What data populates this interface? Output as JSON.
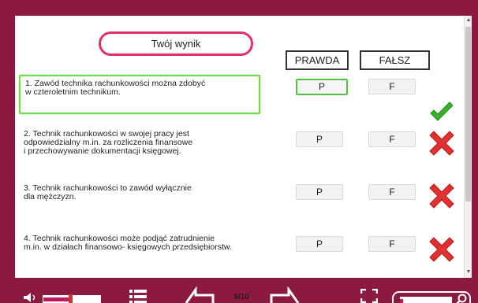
{
  "result_title": "Twój wynik",
  "headers": {
    "true_label": "PRAWDA",
    "false_label": "FAŁSZ"
  },
  "questions": [
    {
      "text": "1. Zawód technika rachunkowości można zdobyć\nw czteroletnim technikum.",
      "true_button": "P",
      "false_button": "F",
      "selected_answer": "P",
      "result": "correct",
      "result_icon": "check-icon"
    },
    {
      "text": "2. Technik rachunkowości w swojej pracy jest\nodpowiedzialny m.in. za rozliczenia finansowe\ni przechowywanie  dokumentacji księgowej.",
      "true_button": "P",
      "false_button": "F",
      "selected_answer": "",
      "result": "incorrect",
      "result_icon": "cross-icon"
    },
    {
      "text": "3. Technik rachunkowości to zawód wyłącznie\ndla mężczyzn.",
      "true_button": "P",
      "false_button": "F",
      "selected_answer": "",
      "result": "incorrect",
      "result_icon": "cross-icon"
    },
    {
      "text": "4. Technik rachunkowości może podjąć zatrudnienie\nm.in. w działach finansowo- księgowych przedsiębiorstw.",
      "true_button": "P",
      "false_button": "F",
      "selected_answer": "",
      "result": "incorrect",
      "result_icon": "cross-icon"
    }
  ],
  "footer": {
    "page_counter": "9/10",
    "volume_level": 0.45,
    "zoom_level": 0.05
  },
  "colors": {
    "frame": "#8c1a3e",
    "accent_pink": "#e0306a",
    "selected_green": "#6fdc4a",
    "check_green": "#3cb02c",
    "cross_red": "#e03030"
  }
}
